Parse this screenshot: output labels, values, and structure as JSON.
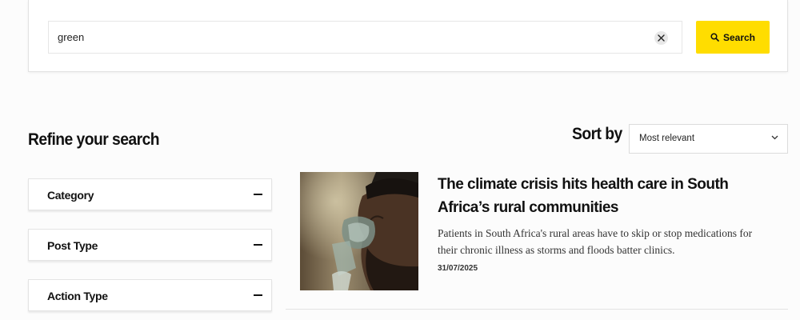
{
  "search": {
    "value": "green",
    "clear_icon": "close-icon",
    "button_label": "Search",
    "button_icon": "search-icon",
    "button_color": "#ffdd00"
  },
  "refine": {
    "title": "Refine your search",
    "filters": [
      {
        "label": "Category",
        "state": "expanded"
      },
      {
        "label": "Post Type",
        "state": "expanded"
      },
      {
        "label": "Action Type",
        "state": "expanded"
      }
    ]
  },
  "sort": {
    "label": "Sort by",
    "selected": "Most relevant"
  },
  "results": [
    {
      "title": "The climate crisis hits health care in South Africa’s rural communities",
      "excerpt": "Patients in South Africa's rural areas have to skip or stop medications for their chronic illness as storms and floods batter clinics.",
      "date": "31/07/2025",
      "image": "man-with-oxygen-mask-photo"
    }
  ]
}
